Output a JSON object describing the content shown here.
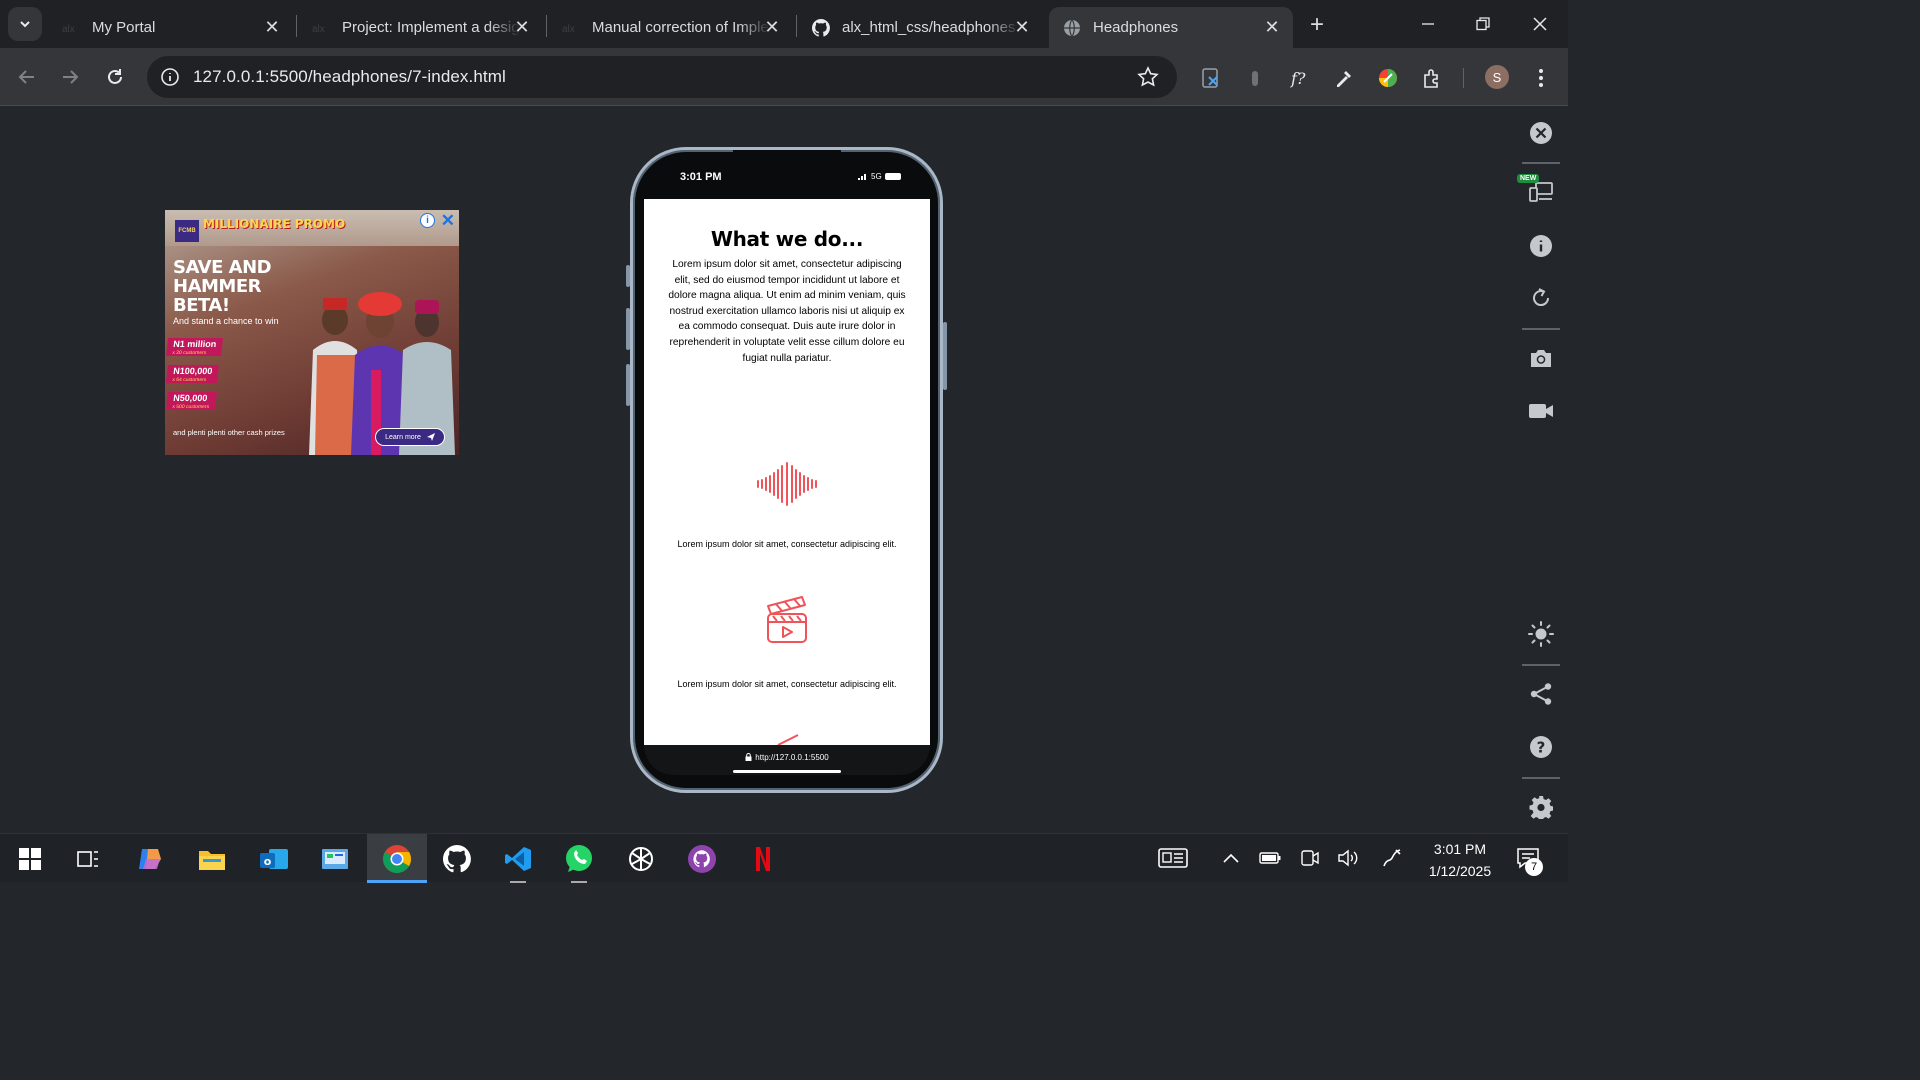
{
  "browser": {
    "tabs": [
      {
        "title": "My Portal",
        "favicon": "alx-icon",
        "active": false
      },
      {
        "title": "Project: Implement a design",
        "favicon": "alx-icon",
        "active": false
      },
      {
        "title": "Manual correction of Implement",
        "favicon": "alx-icon",
        "active": false
      },
      {
        "title": "alx_html_css/headphones",
        "favicon": "github-icon",
        "active": false
      },
      {
        "title": "Headphones",
        "favicon": "globe-icon",
        "active": true
      }
    ],
    "url": "127.0.0.1:5500/headphones/7-index.html",
    "profile_initial": "S"
  },
  "ad": {
    "brand": "FCMB",
    "promo": "MILLIONAIRE PROMO",
    "headline": "SAVE AND HAMMER BETA!",
    "subline": "And stand a chance to win",
    "prizes": [
      {
        "amount": "N1 million",
        "note": "x 20 customers"
      },
      {
        "amount": "N100,000",
        "note": "x 64 customers"
      },
      {
        "amount": "N50,000",
        "note": "x 500 customers"
      }
    ],
    "footer": "and plenti plenti other cash prizes",
    "cta": "Learn more"
  },
  "phone": {
    "status_time": "3:01 PM",
    "network": "5G",
    "heading": "What we do...",
    "paragraph": "Lorem ipsum dolor sit amet, consectetur adipiscing elit, sed do eiusmod tempor incididunt ut labore et dolore magna aliqua. Ut enim ad minim veniam, quis nostrud exercitation ullamco laboris nisi ut aliquip ex ea commodo consequat. Duis aute irure dolor in reprehenderit in voluptate velit esse cillum dolore eu fugiat nulla pariatur.",
    "features": [
      {
        "icon": "sound-wave-icon",
        "text": "Lorem ipsum dolor sit amet, consectetur adipiscing elit."
      },
      {
        "icon": "video-clapper-icon",
        "text": "Lorem ipsum dolor sit amet, consectetur adipiscing elit."
      }
    ],
    "bottom_url": "http://127.0.0.1:5500",
    "accent": "#f0535a"
  },
  "sidepanel": {
    "new_badge": "NEW"
  },
  "taskbar": {
    "time": "3:01 PM",
    "date": "1/12/2025",
    "notification_count": "7"
  }
}
